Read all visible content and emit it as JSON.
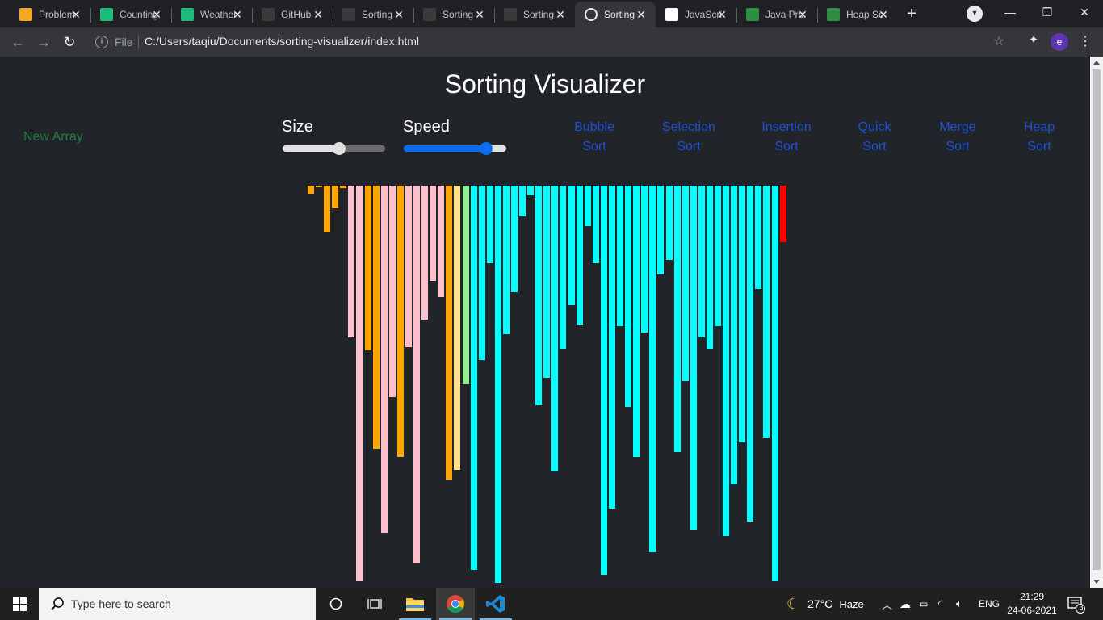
{
  "browser": {
    "tabs": [
      {
        "title": "Problems",
        "icon": "sigma-favicon",
        "color": "#f5a623"
      },
      {
        "title": "Counting",
        "icon": "mdn-favicon",
        "color": "#1fbb7a"
      },
      {
        "title": "Weather",
        "icon": "mdn-favicon",
        "color": "#1fbb7a"
      },
      {
        "title": "GitHub",
        "icon": "github-favicon",
        "color": "#3a3a3a"
      },
      {
        "title": "Sorting",
        "icon": "github-favicon",
        "color": "#3a3a3a"
      },
      {
        "title": "Sorting",
        "icon": "github-favicon",
        "color": "#3a3a3a"
      },
      {
        "title": "Sorting",
        "icon": "github-favicon",
        "color": "#3a3a3a"
      },
      {
        "title": "Sorting",
        "icon": "globe-favicon",
        "color": "#e8eaed",
        "active": true
      },
      {
        "title": "JavaScript",
        "icon": "w3schools-favicon",
        "color": "#ffffff"
      },
      {
        "title": "Java Program",
        "icon": "gfg-favicon",
        "color": "#2f8d46"
      },
      {
        "title": "Heap Sort",
        "icon": "gfg-favicon",
        "color": "#2f8d46"
      }
    ],
    "omnibox": {
      "scheme_label": "File",
      "url": "C:/Users/taqiu/Documents/sorting-visualizer/index.html"
    },
    "profile_initial": "e"
  },
  "app": {
    "title": "Sorting Visualizer",
    "new_array_label": "New Array",
    "size_label": "Size",
    "speed_label": "Speed",
    "size_value": 0.55,
    "speed_value": 0.8,
    "algorithms": [
      {
        "line1": "Bubble",
        "line2": "Sort"
      },
      {
        "line1": "Selection",
        "line2": "Sort"
      },
      {
        "line1": "Insertion",
        "line2": "Sort"
      },
      {
        "line1": "Quick",
        "line2": "Sort"
      },
      {
        "line1": "Merge",
        "line2": "Sort"
      },
      {
        "line1": "Heap",
        "line2": "Sort"
      }
    ],
    "colors": {
      "unsorted": "#ffa500",
      "pink": "#ffc0cb",
      "light_yellow": "#ffe28a",
      "light_green": "#90ee90",
      "cyan": "#00ffff",
      "red": "#ff0000",
      "link": "#1e4fd6",
      "new_array": "#1e7d3e"
    },
    "bars": [
      {
        "v": 10,
        "c": "unsorted"
      },
      {
        "v": 2,
        "c": "unsorted"
      },
      {
        "v": 58,
        "c": "unsorted"
      },
      {
        "v": 28,
        "c": "unsorted"
      },
      {
        "v": 3,
        "c": "unsorted"
      },
      {
        "v": 188,
        "c": "pink"
      },
      {
        "v": 490,
        "c": "pink"
      },
      {
        "v": 204,
        "c": "unsorted"
      },
      {
        "v": 326,
        "c": "unsorted"
      },
      {
        "v": 430,
        "c": "pink"
      },
      {
        "v": 262,
        "c": "pink"
      },
      {
        "v": 336,
        "c": "unsorted"
      },
      {
        "v": 200,
        "c": "pink"
      },
      {
        "v": 468,
        "c": "pink"
      },
      {
        "v": 166,
        "c": "pink"
      },
      {
        "v": 118,
        "c": "pink"
      },
      {
        "v": 138,
        "c": "pink"
      },
      {
        "v": 364,
        "c": "unsorted"
      },
      {
        "v": 352,
        "c": "light_yellow"
      },
      {
        "v": 246,
        "c": "light_green"
      },
      {
        "v": 476,
        "c": "cyan"
      },
      {
        "v": 216,
        "c": "cyan"
      },
      {
        "v": 96,
        "c": "cyan"
      },
      {
        "v": 492,
        "c": "cyan"
      },
      {
        "v": 184,
        "c": "cyan"
      },
      {
        "v": 132,
        "c": "cyan"
      },
      {
        "v": 38,
        "c": "cyan"
      },
      {
        "v": 12,
        "c": "cyan"
      },
      {
        "v": 272,
        "c": "cyan"
      },
      {
        "v": 238,
        "c": "cyan"
      },
      {
        "v": 354,
        "c": "cyan"
      },
      {
        "v": 202,
        "c": "cyan"
      },
      {
        "v": 148,
        "c": "cyan"
      },
      {
        "v": 172,
        "c": "cyan"
      },
      {
        "v": 50,
        "c": "cyan"
      },
      {
        "v": 96,
        "c": "cyan"
      },
      {
        "v": 482,
        "c": "cyan"
      },
      {
        "v": 400,
        "c": "cyan"
      },
      {
        "v": 174,
        "c": "cyan"
      },
      {
        "v": 274,
        "c": "cyan"
      },
      {
        "v": 336,
        "c": "cyan"
      },
      {
        "v": 182,
        "c": "cyan"
      },
      {
        "v": 454,
        "c": "cyan"
      },
      {
        "v": 110,
        "c": "cyan"
      },
      {
        "v": 92,
        "c": "cyan"
      },
      {
        "v": 330,
        "c": "cyan"
      },
      {
        "v": 242,
        "c": "cyan"
      },
      {
        "v": 426,
        "c": "cyan"
      },
      {
        "v": 188,
        "c": "cyan"
      },
      {
        "v": 202,
        "c": "cyan"
      },
      {
        "v": 174,
        "c": "cyan"
      },
      {
        "v": 434,
        "c": "cyan"
      },
      {
        "v": 370,
        "c": "cyan"
      },
      {
        "v": 318,
        "c": "cyan"
      },
      {
        "v": 416,
        "c": "cyan"
      },
      {
        "v": 128,
        "c": "cyan"
      },
      {
        "v": 312,
        "c": "cyan"
      },
      {
        "v": 490,
        "c": "cyan"
      },
      {
        "v": 70,
        "c": "red"
      }
    ]
  },
  "taskbar": {
    "search_placeholder": "Type here to search",
    "weather_temp": "27°C",
    "weather_desc": "Haze",
    "lang": "ENG",
    "time": "21:29",
    "date": "24-06-2021",
    "notifications": "3"
  }
}
